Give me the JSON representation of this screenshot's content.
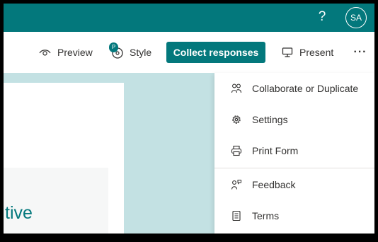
{
  "header": {
    "help_label": "?",
    "avatar_initials": "SA"
  },
  "toolbar": {
    "preview_label": "Preview",
    "style_label": "Style",
    "style_badge": "P",
    "collect_label": "Collect responses",
    "present_label": "Present",
    "more_label": "···"
  },
  "form": {
    "title_fragment": "tive"
  },
  "menu": {
    "items": [
      {
        "label": "Collaborate or Duplicate",
        "icon": "people-icon"
      },
      {
        "label": "Settings",
        "icon": "gear-icon"
      },
      {
        "label": "Print Form",
        "icon": "printer-icon"
      },
      {
        "label": "Feedback",
        "icon": "feedback-icon"
      },
      {
        "label": "Terms",
        "icon": "document-icon"
      }
    ]
  },
  "colors": {
    "brand": "#03787c",
    "canvas_background": "#c3e1e3",
    "text": "#323130"
  }
}
